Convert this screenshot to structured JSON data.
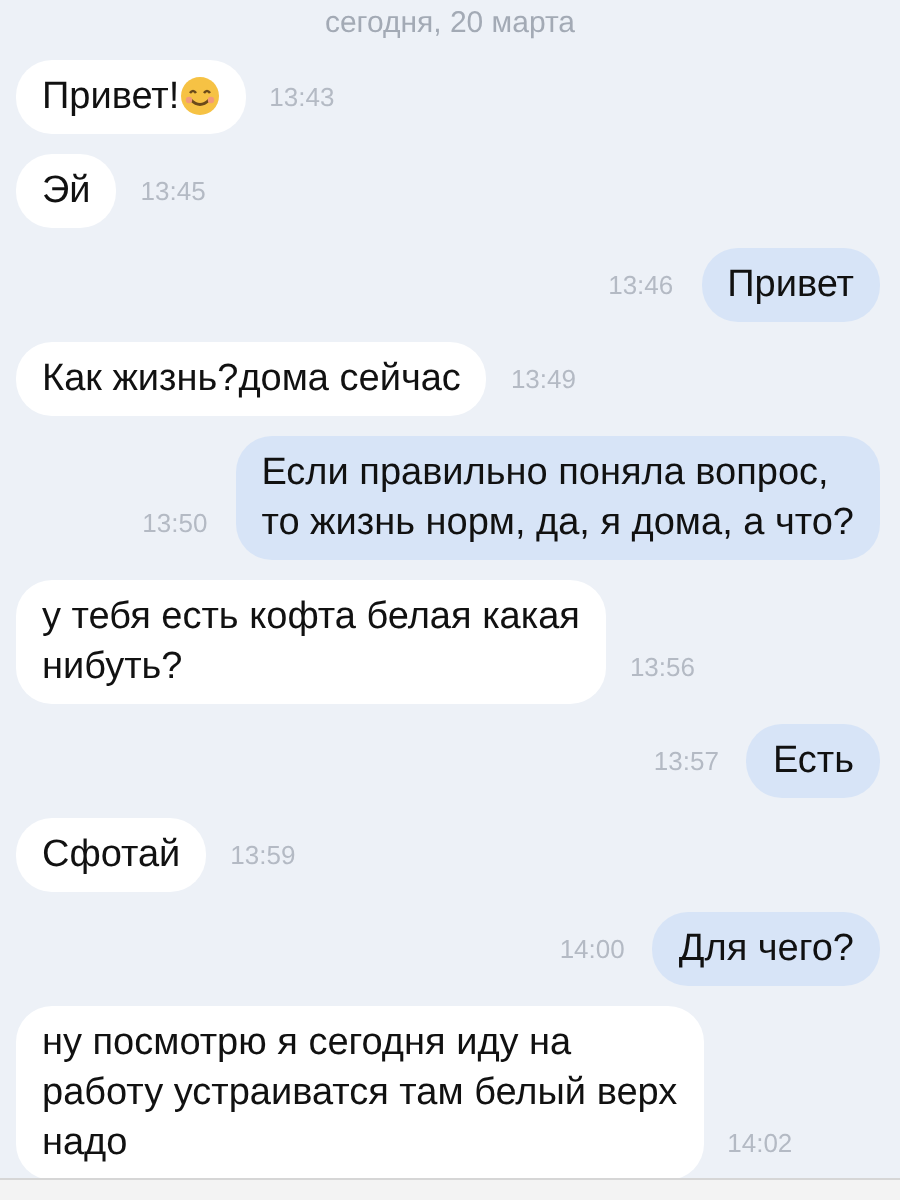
{
  "date_divider": "сегодня, 20 марта",
  "messages": [
    {
      "kind": "in",
      "text": "Привет!",
      "has_emoji": true,
      "time": "13:43"
    },
    {
      "kind": "in",
      "text": "Эй",
      "has_emoji": false,
      "time": "13:45"
    },
    {
      "kind": "out",
      "text": "Привет",
      "has_emoji": false,
      "time": "13:46"
    },
    {
      "kind": "in",
      "text": "Как жизнь?дома сейчас",
      "has_emoji": false,
      "time": "13:49"
    },
    {
      "kind": "out",
      "text": "Если правильно поняла вопрос,\nто жизнь норм, да, я дома, а что?",
      "has_emoji": false,
      "time": "13:50"
    },
    {
      "kind": "in",
      "text": "у тебя есть кофта белая какая\nнибуть?",
      "has_emoji": false,
      "time": "13:56"
    },
    {
      "kind": "out",
      "text": "Есть",
      "has_emoji": false,
      "time": "13:57"
    },
    {
      "kind": "in",
      "text": "Сфотай",
      "has_emoji": false,
      "time": "13:59"
    },
    {
      "kind": "out",
      "text": "Для чего?",
      "has_emoji": false,
      "time": "14:00"
    },
    {
      "kind": "in",
      "text": "ну посмотрю я сегодня иду на\nработу устраиватся там белый верх\nнадо",
      "has_emoji": false,
      "time": "14:02"
    }
  ]
}
